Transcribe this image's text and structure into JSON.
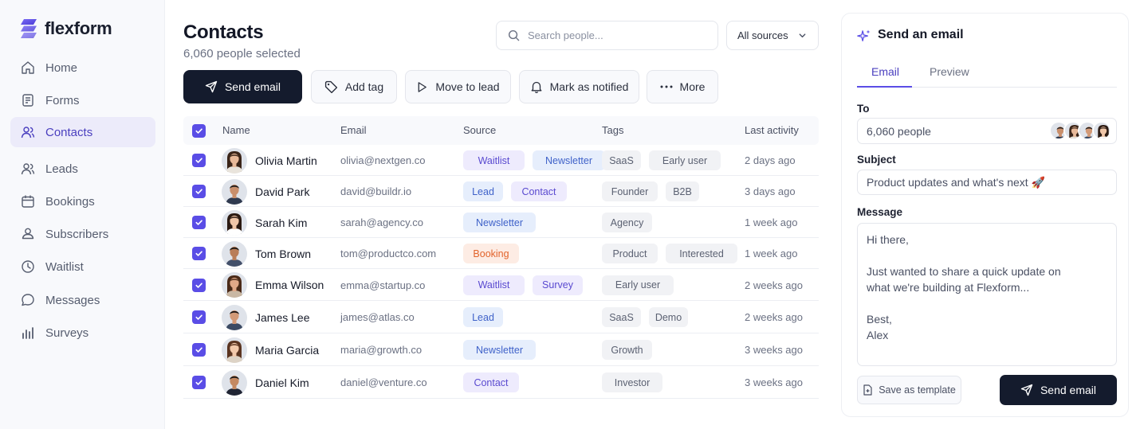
{
  "app": {
    "name": "flexform"
  },
  "sidebar": {
    "items": [
      {
        "label": "Home",
        "icon": "home-icon",
        "active": false
      },
      {
        "label": "Forms",
        "icon": "forms-icon",
        "active": false
      },
      {
        "label": "Contacts",
        "icon": "contacts-icon",
        "active": true
      },
      {
        "label": "Leads",
        "icon": "leads-icon",
        "active": false
      },
      {
        "label": "Bookings",
        "icon": "calendar-icon",
        "active": false
      },
      {
        "label": "Subscribers",
        "icon": "subscribers-icon",
        "active": false
      },
      {
        "label": "Waitlist",
        "icon": "clock-icon",
        "active": false
      },
      {
        "label": "Messages",
        "icon": "chat-icon",
        "active": false
      },
      {
        "label": "Surveys",
        "icon": "bar-chart-icon",
        "active": false
      }
    ]
  },
  "header": {
    "title": "Contacts",
    "subtitle": "6,060 people selected",
    "search_placeholder": "Search people...",
    "source_filter": "All sources"
  },
  "toolbar": {
    "send_email": "Send email",
    "add_tag": "Add tag",
    "move_to_lead": "Move to lead",
    "mark_notified": "Mark as notified",
    "more": "More"
  },
  "table": {
    "columns": [
      "Name",
      "Email",
      "Source",
      "Tags",
      "Last activity"
    ],
    "rows": [
      {
        "name": "Olivia Martin",
        "email": "olivia@nextgen.co",
        "sources": [
          "Waitlist",
          "Newsletter"
        ],
        "tags": [
          "SaaS",
          "Early user"
        ],
        "activity": "2 days ago"
      },
      {
        "name": "David Park",
        "email": "david@buildr.io",
        "sources": [
          "Lead",
          "Contact"
        ],
        "tags": [
          "Founder",
          "B2B"
        ],
        "activity": "3 days ago"
      },
      {
        "name": "Sarah Kim",
        "email": "sarah@agency.co",
        "sources": [
          "Newsletter"
        ],
        "tags": [
          "Agency"
        ],
        "activity": "1 week ago"
      },
      {
        "name": "Tom Brown",
        "email": "tom@productco.com",
        "sources": [
          "Booking"
        ],
        "tags": [
          "Product",
          "Interested"
        ],
        "activity": "1 week ago"
      },
      {
        "name": "Emma Wilson",
        "email": "emma@startup.co",
        "sources": [
          "Waitlist",
          "Survey"
        ],
        "tags": [
          "Early user"
        ],
        "activity": "2 weeks ago"
      },
      {
        "name": "James Lee",
        "email": "james@atlas.co",
        "sources": [
          "Lead"
        ],
        "tags": [
          "SaaS",
          "Demo"
        ],
        "activity": "2 weeks ago"
      },
      {
        "name": "Maria Garcia",
        "email": "maria@growth.co",
        "sources": [
          "Newsletter"
        ],
        "tags": [
          "Growth"
        ],
        "activity": "3 weeks ago"
      },
      {
        "name": "Daniel Kim",
        "email": "daniel@venture.co",
        "sources": [
          "Contact"
        ],
        "tags": [
          "Investor"
        ],
        "activity": "3 weeks ago"
      }
    ]
  },
  "panel": {
    "title": "Send an email",
    "tabs": [
      "Email",
      "Preview"
    ],
    "to_label": "To",
    "to_value": "6,060 people",
    "subject_label": "Subject",
    "subject_value": "Product updates and what's next 🚀",
    "message_label": "Message",
    "message_lines": [
      "Hi there,",
      "",
      "Just wanted to share a quick update on",
      "what we're building at Flexform...",
      "",
      "Best,",
      "Alex"
    ],
    "save_template": "Save as template",
    "send": "Send email"
  },
  "colors": {
    "accent": "#5a4de6",
    "primary_button": "#141b2d",
    "source_purple": "#eeebfd",
    "source_blue": "#e6eefc",
    "source_orange": "#fdece4",
    "tag_gray": "#f1f2f5"
  }
}
